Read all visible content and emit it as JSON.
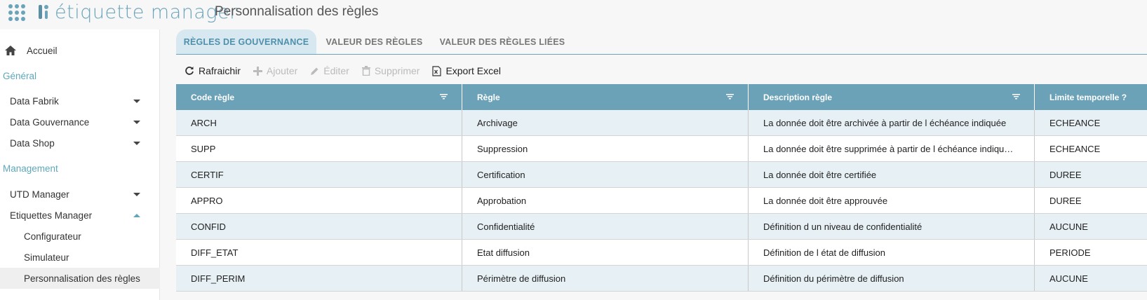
{
  "app": {
    "logo_text": "étiquette manager",
    "page_title": "Personnalisation des règles",
    "accent_color": "#6aa3ba"
  },
  "sidebar": {
    "home": {
      "label": "Accueil",
      "icon": "home-icon"
    },
    "sections": [
      {
        "label": "Général"
      },
      {
        "label": "Management"
      }
    ],
    "items": [
      {
        "label": "Data Fabrik",
        "expanded": false
      },
      {
        "label": "Data Gouvernance",
        "expanded": false
      },
      {
        "label": "Data Shop",
        "expanded": false
      },
      {
        "label": "UTD Manager",
        "expanded": false
      },
      {
        "label": "Etiquettes Manager",
        "expanded": true
      },
      {
        "label": "Configurateur"
      },
      {
        "label": "Simulateur"
      },
      {
        "label": "Personnalisation des règles",
        "active": true
      }
    ]
  },
  "tabs": [
    {
      "label": "RÈGLES DE GOUVERNANCE",
      "active": true
    },
    {
      "label": "VALEUR DES RÈGLES"
    },
    {
      "label": "VALEUR DES RÈGLES LIÉES"
    }
  ],
  "toolbar": {
    "refresh": "Rafraichir",
    "add": "Ajouter",
    "edit": "Éditer",
    "delete": "Supprimer",
    "export": "Export Excel"
  },
  "table": {
    "columns": [
      "Code règle",
      "Règle",
      "Description règle",
      "Limite temporelle ?"
    ],
    "rows": [
      [
        "ARCH",
        "Archivage",
        "La donnée doit être archivée à partir de l échéance indiquée",
        "ECHEANCE"
      ],
      [
        "SUPP",
        "Suppression",
        "La donnée doit être supprimée à partir de l échéance indiqu…",
        "ECHEANCE"
      ],
      [
        "CERTIF",
        "Certification",
        "La donnée doit être certifiée",
        "DUREE"
      ],
      [
        "APPRO",
        "Approbation",
        "La donnée doit être approuvée",
        "DUREE"
      ],
      [
        "CONFID",
        "Confidentialité",
        "Définition d un niveau de confidentialité",
        "AUCUNE"
      ],
      [
        "DIFF_ETAT",
        "Etat diffusion",
        "Définition de l état de diffusion",
        "PERIODE"
      ],
      [
        "DIFF_PERIM",
        "Périmètre de diffusion",
        "Définition du périmètre de diffusion",
        "AUCUNE"
      ]
    ]
  }
}
